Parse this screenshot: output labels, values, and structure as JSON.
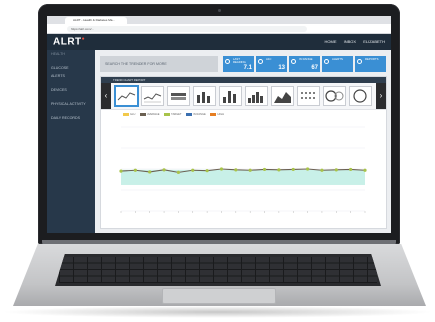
{
  "browser": {
    "tab_title": "ALRT - Health & Diabetes Ma…",
    "url": "https://alrt.com/..."
  },
  "app": {
    "logo": "ALRT",
    "nav": [
      "HOME",
      "INBOX",
      "ELIZABETH"
    ],
    "sidebar_items": [
      "HEALTH",
      "GLUCOSE",
      "ALERTS",
      "DEVICES",
      "PHYSICAL ACTIVITY",
      "DAILY RECORDS"
    ],
    "search_placeholder": "SEARCH THE TRENDER FOR MORE",
    "tiles": [
      {
        "label": "LAST READING",
        "value": "7.1"
      },
      {
        "label": "A1C",
        "value": "13"
      },
      {
        "label": "IN RANGE",
        "value": "67"
      },
      {
        "label": "ALERTS",
        "value": ""
      },
      {
        "label": "REPORTS",
        "value": ""
      }
    ],
    "panel_title": "TREND CHART REPORT",
    "legend": [
      "GLU",
      "AVERAGE",
      "TARGET",
      "IN RANGE",
      "HIGH"
    ]
  },
  "colors": {
    "accent": "#3a8fd4",
    "dark_nav": "#1f2d3b",
    "range_band": "#c8f0e8",
    "line": "#6b6052",
    "points": "#a8c34a"
  },
  "chart_data": {
    "type": "line",
    "series": [
      {
        "values": [
          95,
          97,
          93,
          98,
          92,
          97,
          96,
          100,
          98,
          97,
          99,
          98,
          99,
          100,
          97,
          98,
          99,
          97
        ]
      }
    ],
    "band": [
      62,
      98
    ]
  }
}
